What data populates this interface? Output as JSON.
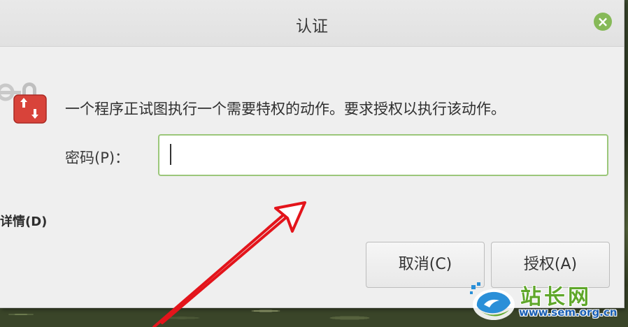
{
  "window": {
    "title": "认证",
    "close_icon": "close-icon"
  },
  "dialog": {
    "icon": "key-lock-icon",
    "message": "一个程序正试图执行一个需要特权的动作。要求授权以执行该动作。",
    "password_label": "密码(P)：",
    "password_value": "",
    "details_label": "详情(D)",
    "cancel_label": "取消(C)",
    "authorize_label": "授权(A)"
  },
  "watermark": {
    "site_name": "站长网",
    "url": "www.sem.org.cn"
  },
  "colors": {
    "accent_green": "#86b958",
    "input_border": "#9bc77a",
    "annotation_arrow": "#e3141b"
  }
}
